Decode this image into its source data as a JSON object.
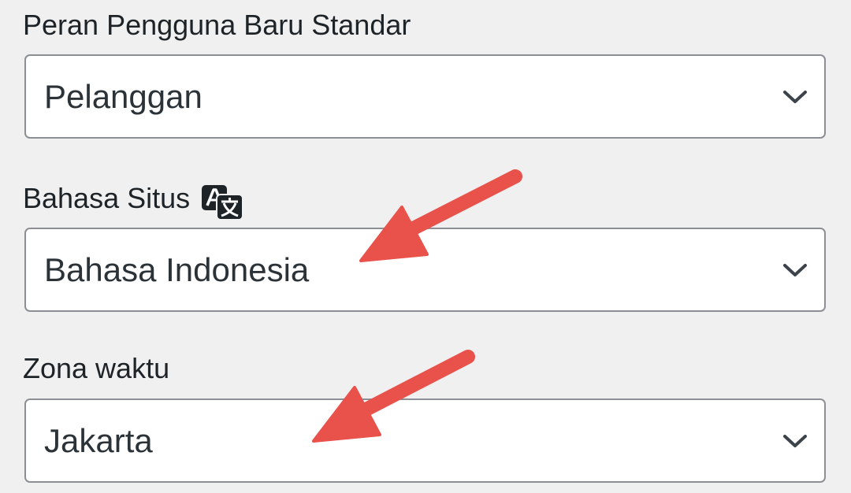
{
  "fields": [
    {
      "label": "Peran Pengguna Baru Standar",
      "value": "Pelanggan"
    },
    {
      "label": "Bahasa Situs",
      "value": "Bahasa Indonesia",
      "icon": "translate-icon"
    },
    {
      "label": "Zona waktu",
      "value": "Jakarta"
    }
  ],
  "colors": {
    "background": "#f0f0f1",
    "text": "#1d2327",
    "select_border": "#8c8f94",
    "arrow": "#e8524b"
  },
  "icons": {
    "dropdown": "chevron-down-icon",
    "language": "translate-icon",
    "annotation": "red-arrow-icon"
  }
}
